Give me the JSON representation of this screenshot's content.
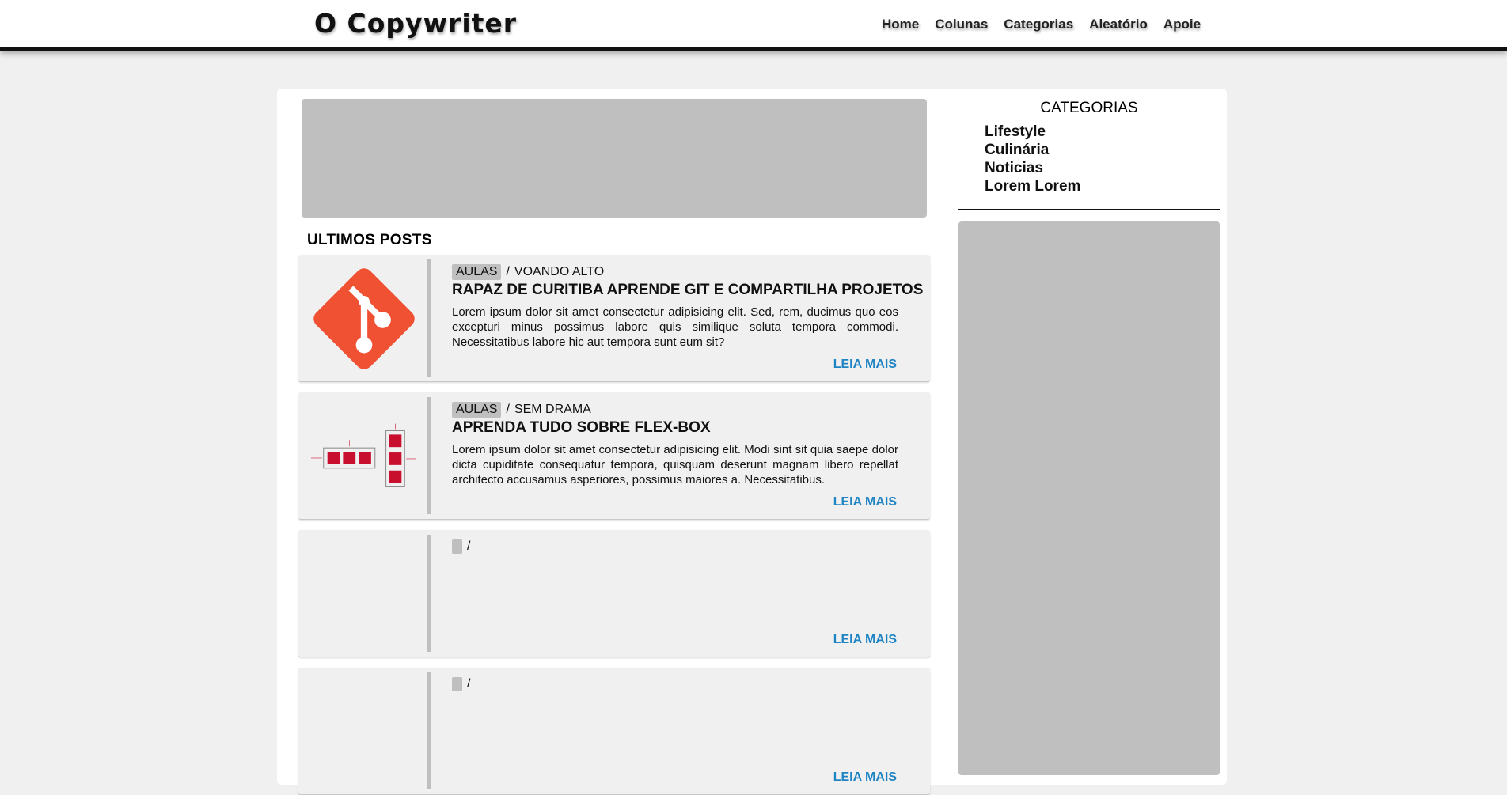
{
  "header": {
    "logo": "O Copywriter",
    "nav": [
      {
        "label": "Home"
      },
      {
        "label": "Colunas"
      },
      {
        "label": "Categorias"
      },
      {
        "label": "Aleatório"
      },
      {
        "label": "Apoie"
      }
    ]
  },
  "main": {
    "section_title": "ULTIMOS POSTS",
    "posts": [
      {
        "tag": "AULAS",
        "separator": "/",
        "author": "VOANDO ALTO",
        "title": "RAPAZ DE CURITIBA APRENDE GIT E COMPARTILHA PROJETOS",
        "excerpt": "Lorem ipsum dolor sit amet consectetur adipisicing elit. Sed, rem, ducimus quo eos excepturi minus possimus labore quis similique soluta tempora commodi. Necessitatibus labore hic aut tempora sunt eum sit?",
        "read_more": "LEIA MAIS",
        "thumb_icon": "git-logo-icon"
      },
      {
        "tag": "AULAS",
        "separator": "/",
        "author": "SEM DRAMA",
        "title": "APRENDA TUDO SOBRE FLEX-BOX",
        "excerpt": "Lorem ipsum dolor sit amet consectetur adipisicing elit. Modi sint sit quia saepe dolor dicta cupiditate consequatur tempora, quisquam deserunt magnam libero repellat architecto accusamus asperiores, possimus maiores a. Necessitatibus.",
        "read_more": "LEIA MAIS",
        "thumb_icon": "flexbox-diagram-icon"
      },
      {
        "tag": "",
        "separator": "/",
        "author": "",
        "title": "",
        "excerpt": "",
        "read_more": "LEIA MAIS"
      },
      {
        "tag": "",
        "separator": "/",
        "author": "",
        "title": "",
        "excerpt": "",
        "read_more": "LEIA MAIS"
      }
    ]
  },
  "sidebar": {
    "title": "CATEGORIAS",
    "categories": [
      "Lifestyle",
      "Culinária",
      "Noticias",
      "Lorem Lorem"
    ]
  },
  "colors": {
    "accent_link": "#1e84c4",
    "placeholder_gray": "#c0bfc0",
    "git_orange": "#f05133",
    "flex_red": "#c8102e"
  }
}
